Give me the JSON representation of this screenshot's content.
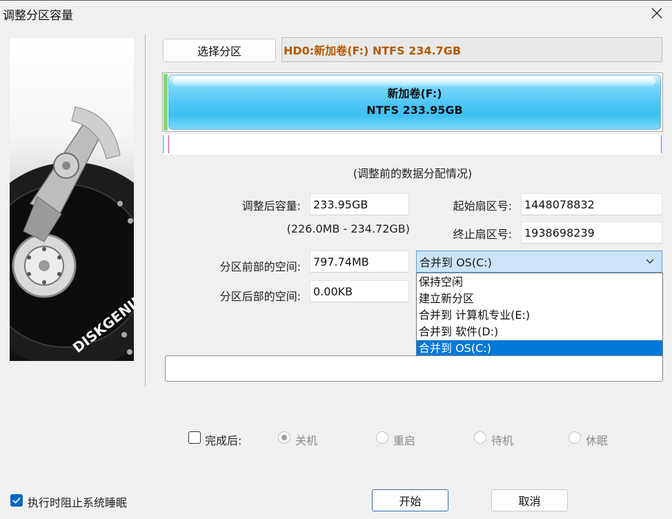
{
  "window": {
    "title": "调整分区容量"
  },
  "select_partition_button": "选择分区",
  "disk_info": "HD0:新加卷(F:) NTFS 234.7GB",
  "partition_bar": {
    "name": "新加卷(F:)",
    "detail": "NTFS 233.95GB"
  },
  "caption": "(调整前的数据分配情况)",
  "form": {
    "new_size_label": "调整后容量:",
    "new_size_value": "233.95GB",
    "size_range": "(226.0MB - 234.72GB)",
    "start_sector_label": "起始扇区号:",
    "start_sector_value": "1448078832",
    "end_sector_label": "终止扇区号:",
    "end_sector_value": "1938698239",
    "space_before_label": "分区前部的空间:",
    "space_before_value": "797.74MB",
    "space_after_label": "分区后部的空间:",
    "space_after_value": "0.00KB"
  },
  "combo": {
    "selected": "合并到 OS(C:)",
    "options": [
      "保持空闲",
      "建立新分区",
      "合并到 计算机专业(E:)",
      "合并到 软件(D:)",
      "合并到 OS(C:)"
    ]
  },
  "after_completion": {
    "label": "完成后:",
    "options": [
      "关机",
      "重启",
      "待机",
      "休眠"
    ]
  },
  "prevent_sleep_label": "执行时阻止系统睡眠",
  "start_button": "开始",
  "cancel_button": "取消",
  "colors": {
    "disk_info_text": "#b35a00",
    "partition_fill": "#4ac5f6",
    "selection": "#0078d7"
  },
  "brand_text": "DISKGENIUS"
}
